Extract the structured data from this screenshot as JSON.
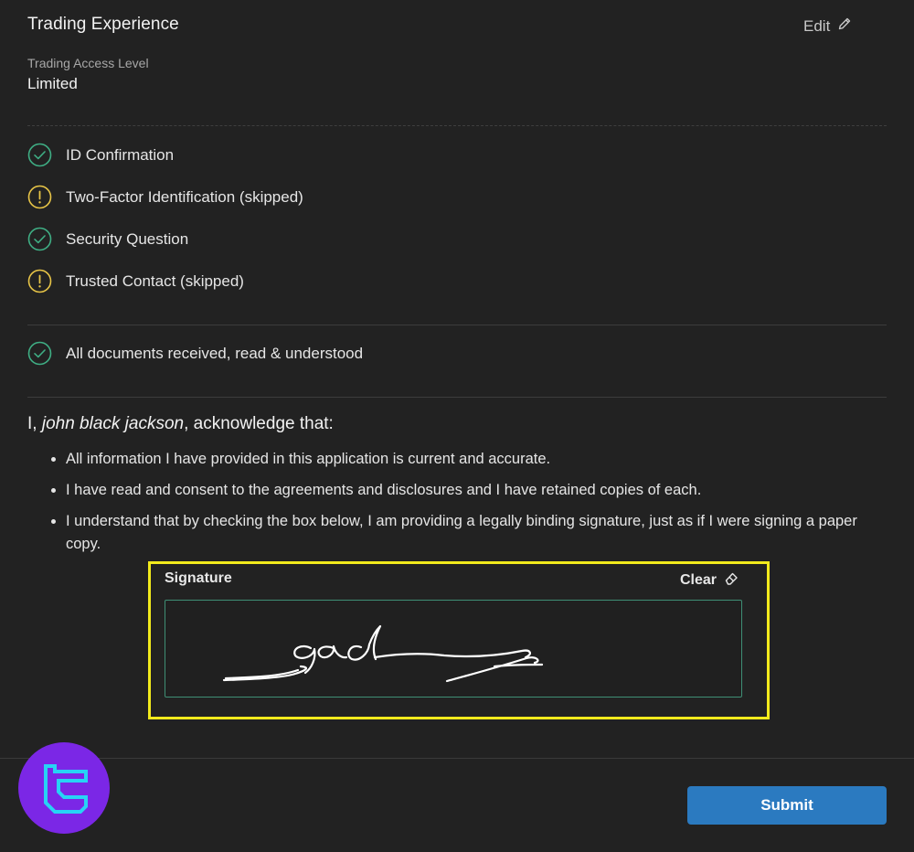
{
  "section": {
    "title": "Trading Experience",
    "edit_label": "Edit",
    "access_level_label": "Trading Access Level",
    "access_level_value": "Limited"
  },
  "checklist": [
    {
      "label": "ID Confirmation",
      "status": "complete"
    },
    {
      "label": "Two-Factor Identification (skipped)",
      "status": "warning"
    },
    {
      "label": "Security Question",
      "status": "complete"
    },
    {
      "label": "Trusted Contact (skipped)",
      "status": "warning"
    }
  ],
  "documents": {
    "label": "All documents received, read & understood",
    "status": "complete"
  },
  "acknowledgement": {
    "prefix": "I, ",
    "name": "john black jackson",
    "suffix": ", acknowledge that:",
    "items": [
      "All information I have provided in this application is current and accurate.",
      "I have read and consent to the agreements and disclosures and I have retained copies of each.",
      "I understand that by checking the box below, I am providing a legally binding signature, just as if I were signing a paper copy."
    ]
  },
  "signature": {
    "label": "Signature",
    "clear_label": "Clear"
  },
  "footer": {
    "submit_label": "Submit"
  },
  "colors": {
    "background": "#222222",
    "success": "#3fae84",
    "warning": "#e8c547",
    "highlight": "#f2ea1c",
    "primary_button": "#2b7ac0",
    "logo_bg": "#7b27e6",
    "logo_fg": "#27d3f5"
  },
  "icons": {
    "complete": "check-circle-icon",
    "warning": "warning-circle-icon",
    "edit": "pencil-icon",
    "clear": "eraser-icon"
  }
}
